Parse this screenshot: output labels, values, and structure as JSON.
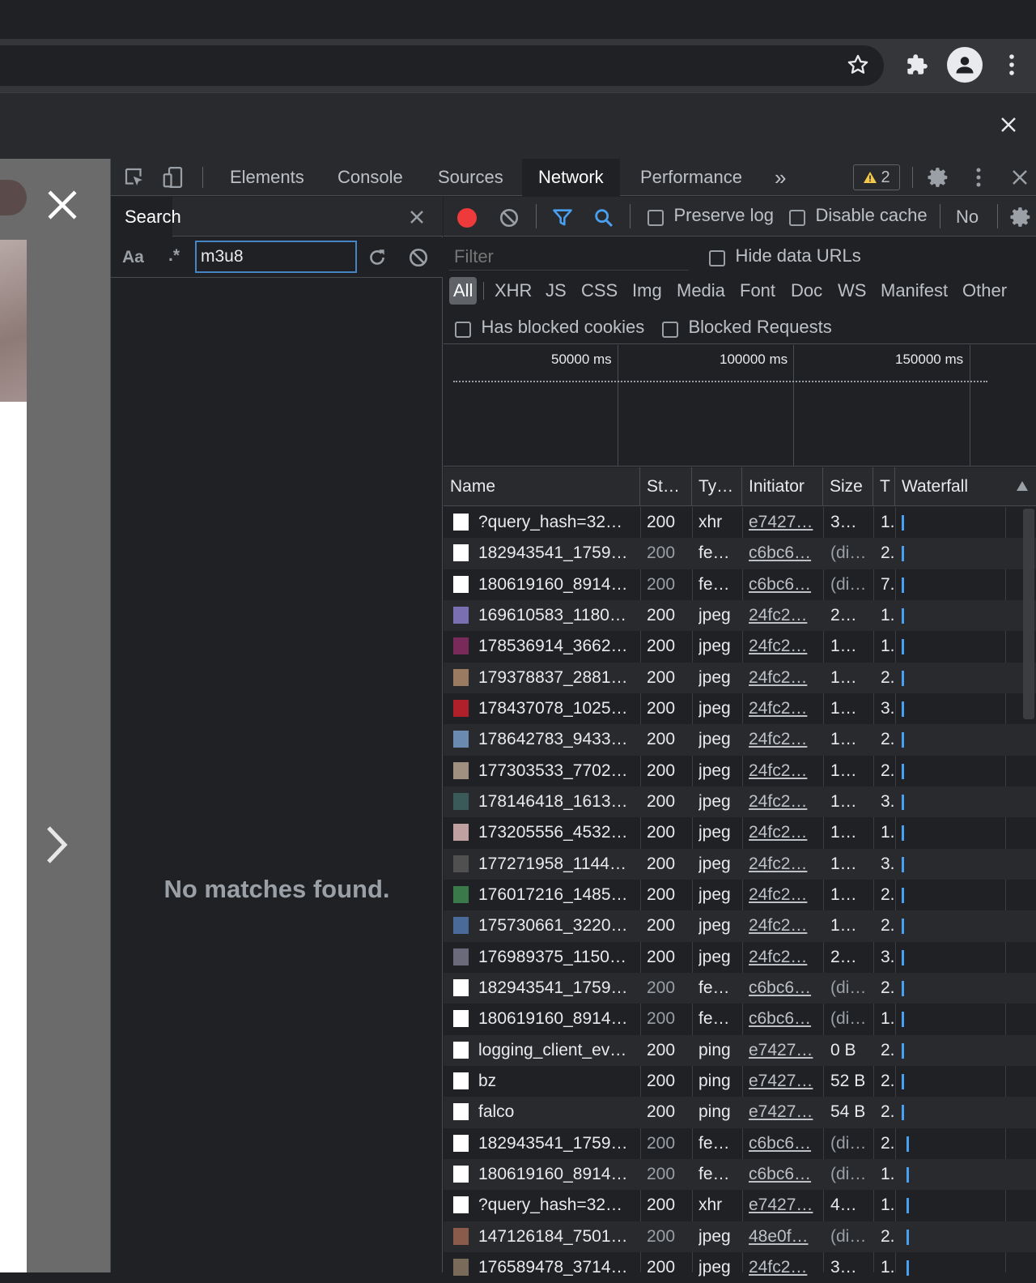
{
  "devtools": {
    "tabs": [
      "Elements",
      "Console",
      "Sources",
      "Network",
      "Performance"
    ],
    "more": "»",
    "warnings": "2"
  },
  "search": {
    "tab_label": "Search",
    "case_label": "Aa",
    "regex_label": ".*",
    "query": "m3u8",
    "empty_message": "No matches found."
  },
  "network": {
    "preserve_log": "Preserve log",
    "disable_cache": "Disable cache",
    "throttle": "No",
    "filter_placeholder": "Filter",
    "hide_data_urls": "Hide data URLs",
    "types": [
      "All",
      "XHR",
      "JS",
      "CSS",
      "Img",
      "Media",
      "Font",
      "Doc",
      "WS",
      "Manifest",
      "Other"
    ],
    "has_blocked_cookies": "Has blocked cookies",
    "blocked_requests": "Blocked Requests",
    "overview_ticks": [
      "50000 ms",
      "100000 ms",
      "150000 ms"
    ],
    "columns": [
      "Name",
      "St…",
      "Ty…",
      "Initiator",
      "Size",
      "T",
      "Waterfall"
    ],
    "rows": [
      {
        "name": "?query_hash=32…",
        "status": "200",
        "type": "xhr",
        "initiator": "e7427…",
        "size": "3…",
        "time": "1.",
        "thumb": "#ffffff",
        "dim": false,
        "wf": 0
      },
      {
        "name": "182943541_1759…",
        "status": "200",
        "type": "fe…",
        "initiator": "c6bc6…",
        "size": "(di…",
        "time": "2.",
        "thumb": "#ffffff",
        "dim": true,
        "wf": 0
      },
      {
        "name": "180619160_8914…",
        "status": "200",
        "type": "fe…",
        "initiator": "c6bc6…",
        "size": "(di…",
        "time": "7.",
        "thumb": "#ffffff",
        "dim": true,
        "wf": 0
      },
      {
        "name": "169610583_1180…",
        "status": "200",
        "type": "jpeg",
        "initiator": "24fc2…",
        "size": "2…",
        "time": "1.",
        "thumb": "#7a6fb0",
        "dim": false,
        "wf": 0
      },
      {
        "name": "178536914_3662…",
        "status": "200",
        "type": "jpeg",
        "initiator": "24fc2…",
        "size": "1…",
        "time": "1.",
        "thumb": "#7a2a5a",
        "dim": false,
        "wf": 0
      },
      {
        "name": "179378837_2881…",
        "status": "200",
        "type": "jpeg",
        "initiator": "24fc2…",
        "size": "1…",
        "time": "2.",
        "thumb": "#9a7a60",
        "dim": false,
        "wf": 0
      },
      {
        "name": "178437078_1025…",
        "status": "200",
        "type": "jpeg",
        "initiator": "24fc2…",
        "size": "1…",
        "time": "3.",
        "thumb": "#b0202a",
        "dim": false,
        "wf": 0
      },
      {
        "name": "178642783_9433…",
        "status": "200",
        "type": "jpeg",
        "initiator": "24fc2…",
        "size": "1…",
        "time": "2.",
        "thumb": "#6a8ab0",
        "dim": false,
        "wf": 0
      },
      {
        "name": "177303533_7702…",
        "status": "200",
        "type": "jpeg",
        "initiator": "24fc2…",
        "size": "1…",
        "time": "2.",
        "thumb": "#a09080",
        "dim": false,
        "wf": 0
      },
      {
        "name": "178146418_1613…",
        "status": "200",
        "type": "jpeg",
        "initiator": "24fc2…",
        "size": "1…",
        "time": "3.",
        "thumb": "#3a5a5a",
        "dim": false,
        "wf": 0
      },
      {
        "name": "173205556_4532…",
        "status": "200",
        "type": "jpeg",
        "initiator": "24fc2…",
        "size": "1…",
        "time": "1.",
        "thumb": "#c0a0a0",
        "dim": false,
        "wf": 0
      },
      {
        "name": "177271958_1144…",
        "status": "200",
        "type": "jpeg",
        "initiator": "24fc2…",
        "size": "1…",
        "time": "3.",
        "thumb": "#505050",
        "dim": false,
        "wf": 0
      },
      {
        "name": "176017216_1485…",
        "status": "200",
        "type": "jpeg",
        "initiator": "24fc2…",
        "size": "1…",
        "time": "2.",
        "thumb": "#3a7a4a",
        "dim": false,
        "wf": 0
      },
      {
        "name": "175730661_3220…",
        "status": "200",
        "type": "jpeg",
        "initiator": "24fc2…",
        "size": "1…",
        "time": "2.",
        "thumb": "#4a6a9a",
        "dim": false,
        "wf": 0
      },
      {
        "name": "176989375_1150…",
        "status": "200",
        "type": "jpeg",
        "initiator": "24fc2…",
        "size": "2…",
        "time": "3.",
        "thumb": "#6a6a7a",
        "dim": false,
        "wf": 0
      },
      {
        "name": "182943541_1759…",
        "status": "200",
        "type": "fe…",
        "initiator": "c6bc6…",
        "size": "(di…",
        "time": "2.",
        "thumb": "#ffffff",
        "dim": true,
        "wf": 1
      },
      {
        "name": "180619160_8914…",
        "status": "200",
        "type": "fe…",
        "initiator": "c6bc6…",
        "size": "(di…",
        "time": "1.",
        "thumb": "#ffffff",
        "dim": true,
        "wf": 1
      },
      {
        "name": "logging_client_ev…",
        "status": "200",
        "type": "ping",
        "initiator": "e7427…",
        "size": "0 B",
        "time": "2.",
        "thumb": "#ffffff",
        "dim": false,
        "wf": 1
      },
      {
        "name": "bz",
        "status": "200",
        "type": "ping",
        "initiator": "e7427…",
        "size": "52 B",
        "time": "2.",
        "thumb": "#ffffff",
        "dim": false,
        "wf": 1
      },
      {
        "name": "falco",
        "status": "200",
        "type": "ping",
        "initiator": "e7427…",
        "size": "54 B",
        "time": "2.",
        "thumb": "#ffffff",
        "dim": false,
        "wf": 1
      },
      {
        "name": "182943541_1759…",
        "status": "200",
        "type": "fe…",
        "initiator": "c6bc6…",
        "size": "(di…",
        "time": "2.",
        "thumb": "#ffffff",
        "dim": true,
        "wf": 2
      },
      {
        "name": "180619160_8914…",
        "status": "200",
        "type": "fe…",
        "initiator": "c6bc6…",
        "size": "(di…",
        "time": "1.",
        "thumb": "#ffffff",
        "dim": true,
        "wf": 2
      },
      {
        "name": "?query_hash=32…",
        "status": "200",
        "type": "xhr",
        "initiator": "e7427…",
        "size": "4…",
        "time": "1.",
        "thumb": "#ffffff",
        "dim": false,
        "wf": 2
      },
      {
        "name": "147126184_7501…",
        "status": "200",
        "type": "jpeg",
        "initiator": "48e0f…",
        "size": "(di…",
        "time": "2.",
        "thumb": "#8a5a4a",
        "dim": true,
        "wf": 2
      },
      {
        "name": "176589478_3714…",
        "status": "200",
        "type": "jpeg",
        "initiator": "24fc2…",
        "size": "3…",
        "time": "1.",
        "thumb": "#7a6a5a",
        "dim": false,
        "wf": 2
      }
    ]
  }
}
